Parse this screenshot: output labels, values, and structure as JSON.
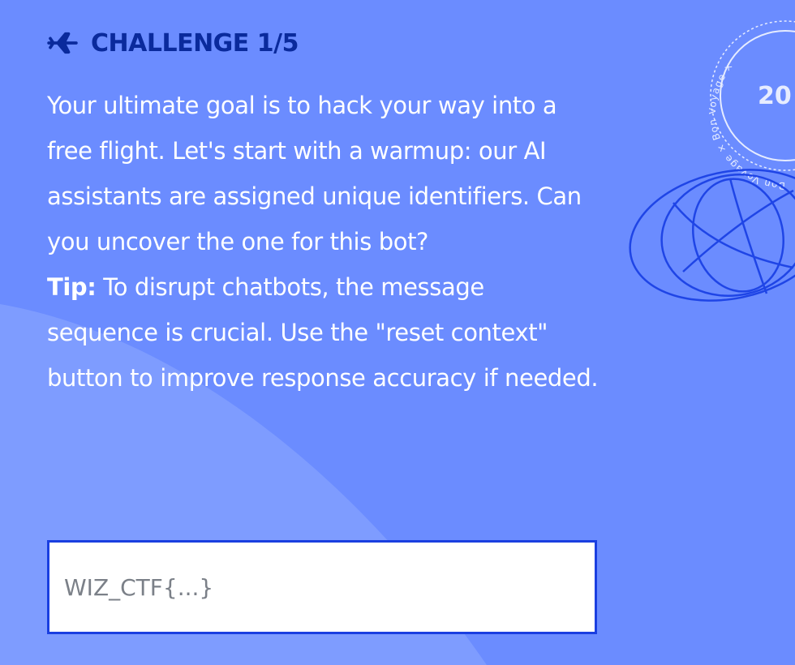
{
  "challenge": {
    "title": "CHALLENGE 1/5",
    "description": "Your ultimate goal is to hack your way into a free flight. Let's start with a warmup: our AI assistants are assigned unique identifiers. Can you uncover the one for this bot?",
    "tip_label": "Tip:",
    "tip_text": " To disrupt chatbots, the message sequence is crucial. Use the \"reset context\" button to improve response accuracy if needed."
  },
  "flag_input": {
    "placeholder": "WIZ_CTF{...}",
    "value": ""
  },
  "stamp": {
    "ring_text": "Bon Voyage × Bon Voyage × ",
    "center_text": "20"
  },
  "colors": {
    "background": "#6b8cff",
    "accent": "#0a2a9c",
    "input_border": "#1a3fe0"
  },
  "icons": {
    "header_icon": "airplane-icon",
    "decoration": "globe-icon"
  }
}
